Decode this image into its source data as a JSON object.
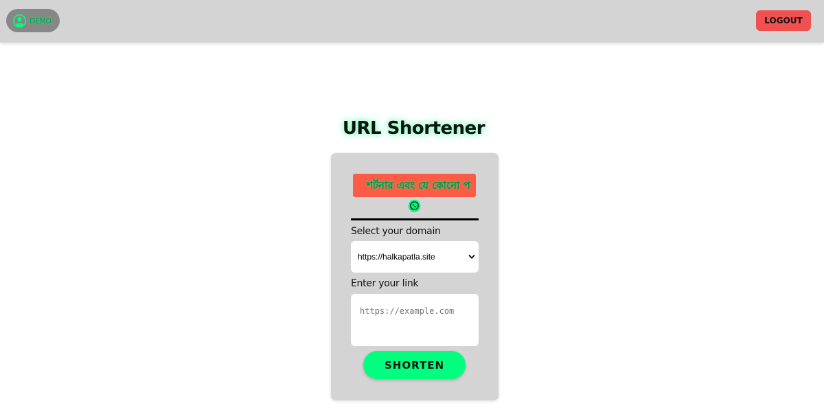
{
  "header": {
    "user_label": "DEMO",
    "logout_label": "LOGOUT",
    "colors": {
      "bar": "#d4d4d4",
      "pill": "#878787",
      "accent_green": "#00ff7f",
      "logout": "#f0504f"
    }
  },
  "main": {
    "title": "URL Shortener"
  },
  "card": {
    "marquee_text": "শর্টনার এবং যে কোনো প",
    "domain_label": "Select your domain",
    "domain_selected": "https://halkapatla.site",
    "link_label": "Enter your link",
    "link_placeholder": "https://example.com",
    "link_value": "",
    "shorten_label": "SHORTEN",
    "icons": [
      "whatsapp-icon",
      "chevron-down-icon"
    ],
    "colors": {
      "card": "#d4d4d4",
      "marquee_bg": "#fd5b46",
      "button": "#00ff7f"
    }
  }
}
